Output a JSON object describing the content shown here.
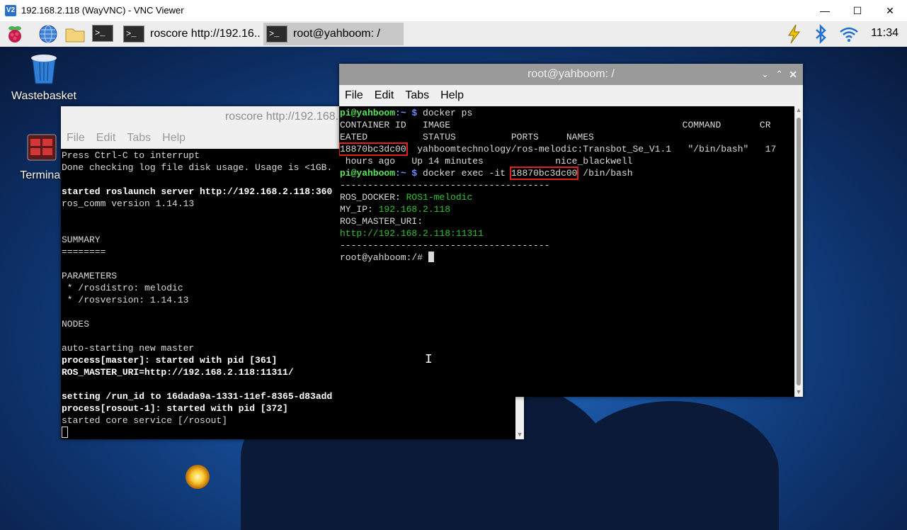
{
  "vnc_window": {
    "logo_text": "V2",
    "title": "192.168.2.118 (WayVNC) - VNC Viewer",
    "minimize": "—",
    "maximize": "☐",
    "close": "✕"
  },
  "taskbar": {
    "tasks": [
      {
        "label": "roscore http://192.16..",
        "active": false
      },
      {
        "label": "root@yahboom: /",
        "active": true
      }
    ],
    "term_glyph": ">_",
    "clock": "11:34"
  },
  "desktop": {
    "icons": [
      {
        "label": "Wastebasket"
      },
      {
        "label": "Terminat"
      }
    ]
  },
  "roscore_window": {
    "title": "roscore http://192.168.2.11",
    "menu": [
      "File",
      "Edit",
      "Tabs",
      "Help"
    ],
    "lines": [
      "Press Ctrl-C to interrupt",
      "Done checking log file disk usage. Usage is <1GB.",
      "",
      "started roslaunch server http://192.168.2.118:360",
      "ros_comm version 1.14.13",
      "",
      "",
      "SUMMARY",
      "========",
      "",
      "PARAMETERS",
      " * /rosdistro: melodic",
      " * /rosversion: 1.14.13",
      "",
      "NODES",
      "",
      "auto-starting new master",
      "process[master]: started with pid [361]",
      "ROS_MASTER_URI=http://192.168.2.118:11311/",
      "",
      "setting /run_id to 16dada9a-1331-11ef-8365-d83add",
      "process[rosout-1]: started with pid [372]",
      "started core service [/rosout]"
    ]
  },
  "root_window": {
    "title": "root@yahboom: /",
    "menu": [
      "File",
      "Edit",
      "Tabs",
      "Help"
    ],
    "prompt_user": "pi@yahboom",
    "prompt_path": ":~ $ ",
    "cmd1": "docker ps",
    "header1": "CONTAINER ID   IMAGE                                          COMMAND       CR",
    "header2": "EATED          STATUS          PORTS     NAMES",
    "container_id": "18870bc3dc00",
    "row1_rest": "  yahboomtechnology/ros-melodic:Transbot_Se_V1.1   \"/bin/bash\"   17",
    "row2": " hours ago   Up 14 minutes             nice_blackwell",
    "cmd2_pre": "docker exec -it ",
    "cmd2_post": " /bin/bash",
    "dashes": "--------------------------------------",
    "ros_docker_label": "ROS_DOCKER: ",
    "ros_docker_value": "ROS1-melodic",
    "my_ip_label": "MY_IP: ",
    "my_ip_value": "192.168.2.118",
    "ros_master_label": "ROS_MASTER_URI:",
    "ros_master_value": "http://192.168.2.118:11311",
    "root_prompt": "root@yahboom:/# "
  }
}
